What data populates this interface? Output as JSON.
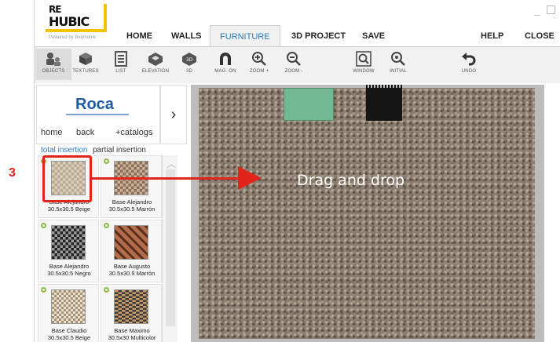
{
  "logo": {
    "line1": "RE",
    "line2": "HUBIC",
    "powered": "Powered by Biophome"
  },
  "menu": [
    {
      "label": "HOME"
    },
    {
      "label": "WALLS"
    },
    {
      "label": "FURNITURE"
    },
    {
      "label": "3D PROJECT"
    },
    {
      "label": "SAVE"
    },
    {
      "label": "HELP"
    },
    {
      "label": "CLOSE"
    }
  ],
  "toolbar": [
    {
      "label": "OBJECTS",
      "icon": "objects-icon"
    },
    {
      "label": "TEXTURES",
      "icon": "textures-icon"
    },
    {
      "label": "LIST",
      "icon": "list-icon"
    },
    {
      "label": "ELEVATION",
      "icon": "elevation-icon"
    },
    {
      "label": "3D",
      "icon": "3d-icon"
    },
    {
      "label": "MAG. ON",
      "icon": "magnet-icon"
    },
    {
      "label": "ZOOM +",
      "icon": "zoom-in-icon"
    },
    {
      "label": "ZOOM -",
      "icon": "zoom-out-icon"
    },
    {
      "label": "WINDOW",
      "icon": "zoom-window-icon"
    },
    {
      "label": "INITIAL",
      "icon": "zoom-initial-icon"
    },
    {
      "label": "UNDO",
      "icon": "undo-icon"
    }
  ],
  "catalog": {
    "brand": "Roca",
    "links": [
      "home",
      "back",
      "+catalogs"
    ]
  },
  "insertion_tabs": [
    "total insertion",
    "partial insertion"
  ],
  "products": [
    {
      "line1": "Base Alejandro",
      "line2": "30.5x30.5 Beige"
    },
    {
      "line1": "Base Alejandro",
      "line2": "30.5x30.5 Marrón"
    },
    {
      "line1": "Base Alejandro",
      "line2": "30.5x30.5 Negro"
    },
    {
      "line1": "Base Augusto",
      "line2": "30.5x30.5 Marrón"
    },
    {
      "line1": "Base Claudio",
      "line2": "30.5x30.5 Beige"
    },
    {
      "line1": "Base Maximo",
      "line2": "30.5x30 Multicolor"
    }
  ],
  "annotation": {
    "step": "3",
    "instruction": "Drag and drop"
  },
  "colors": {
    "accent": "#2a7ab8",
    "annotation": "#e3241c",
    "logo_yellow": "#f2c400"
  }
}
